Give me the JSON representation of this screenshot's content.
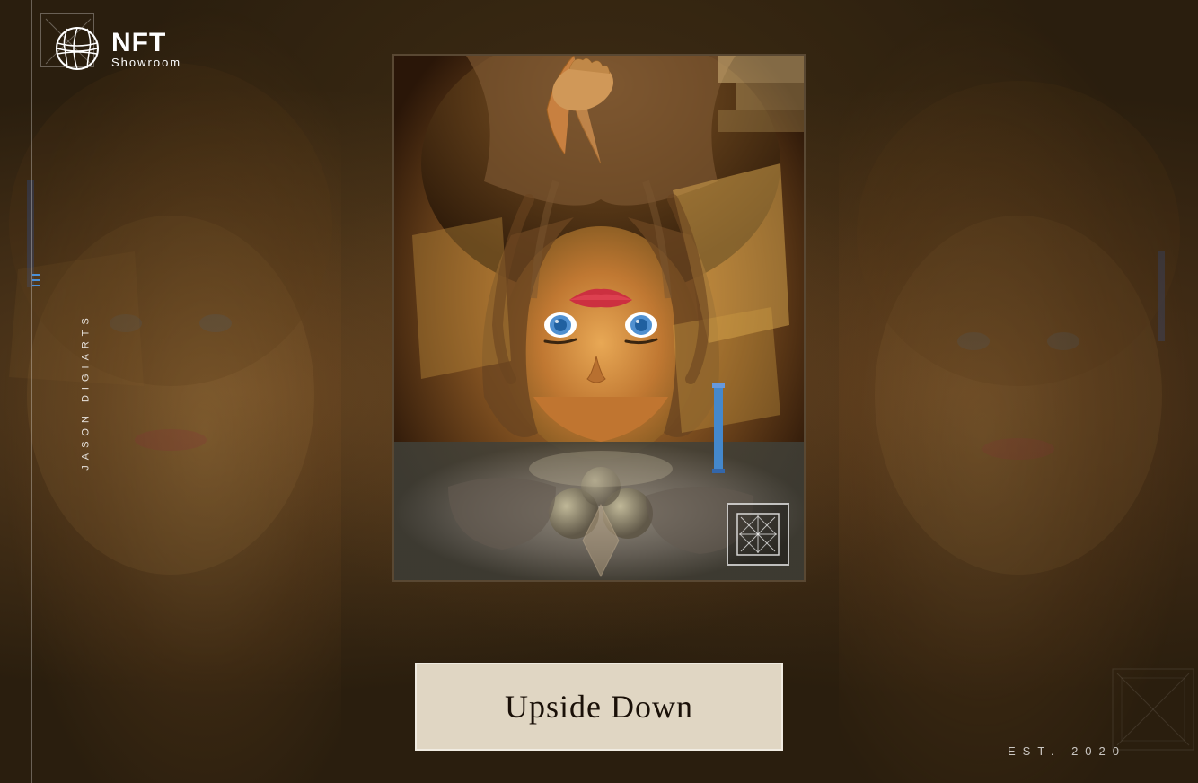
{
  "brand": {
    "nft_label": "NFT",
    "showroom_label": "Showroom",
    "logo_icon": "globe-icon"
  },
  "sidebar": {
    "vertical_text": "JASON DIGIARTS",
    "line_label": "vertical-line"
  },
  "artwork": {
    "title": "Upside Down",
    "watermark_icon": "diamond-cross-icon"
  },
  "footer": {
    "est_label": "EST. 2020"
  },
  "decorations": {
    "corner_tl": "corner-bracket-top-left",
    "corner_br": "corner-bracket-bottom-right"
  }
}
